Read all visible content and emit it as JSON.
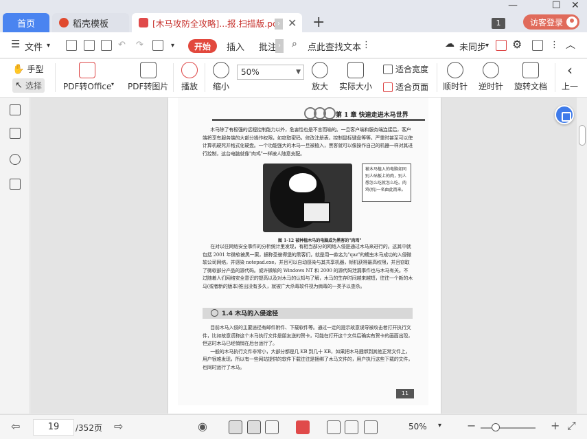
{
  "tabs": {
    "home": "首页",
    "template": "稻壳模板",
    "doc": "[木马攻防全攻略]...报.扫描版.pdf",
    "count": "1"
  },
  "account": {
    "login": "访客登录"
  },
  "menu": {
    "file": "文件",
    "start": "开始",
    "insert": "插入",
    "annotate": "批注",
    "search": "点此查找文本",
    "sync": "未同步"
  },
  "toolbar": {
    "hand": "手型",
    "select": "选择",
    "pdf_to_office": "PDF转Office",
    "pdf_to_image": "PDF转图片",
    "play": "播放",
    "zoom_out": "缩小",
    "zoom_value": "50%",
    "zoom_in": "放大",
    "actual_size": "实际大小",
    "fit_width": "适合宽度",
    "fit_page": "适合页面",
    "rotate_cw": "顺时针",
    "rotate_ccw": "逆时针",
    "rotate_doc": "旋转文档",
    "prev": "上一"
  },
  "document": {
    "chapter_title": "第 1 章   快速走进木马世界",
    "para1": "木马除了有极强的远程控制能力以外，危害性也是不言而喻的。一旦客户端和服务端连接后，客户端将享有服务端的大部分操作权限，如窃取密码，修改注册表，控制鼠标键盘等等。严重时甚至可以使计算机硬死并格式化硬盘。一个功能强大的木马一旦被植入，黑客就可以像操作自己的机器一样对其进行控制，这台电脑就像\"肉鸡\"一样被人随意支配。",
    "speech": "被木马植入的电脑如同别人砧板上的肉，别人想怎么吃就怎么吃。肉鸡(机)一名由此而来。",
    "figure_caption": "图 1-12  被种植木马的电脑成为黑客的\"肉鸡\"",
    "para2": "在对以往网络安全事件的分析统计里发现，有相当部分的网络入侵是通过木马来进行的。这其中就包括 2001 年微软被黑一案，据称圣彼得堡的黑客们，就是用一款名为\"qaz\"的蠕虫木马成功的入侵微软公司网络，并感染 notepad.exe，并且可以自动感染与其共享机器，帧机获得最高权限，并且窃取了微软部分产品的源代码。或许微软的 Windows NT 和 2000 的源代码泄漏事件也与木马有关。不过随着人们网络安全意识的提高以及对木马的认知与了解，木马的生存时间越来越短，往往一个新的木马(或者新的版本)推出没有多久，就被广大杀毒软件视为病毒的一类予以查杀。",
    "section_title": "1.4  木马的入侵途径",
    "para3": "目前木马入侵的主要途径有邮件附件、下载软件等。通过一定的提示故意误导被攻击者打开执行文件，比如故意谎称这个木马执行文件是朋友送的贺卡，可能在打开这个文件后确实有贺卡的画面出现，但这时木马已经悄悄在后台运行了。",
    "para4": "一般的木马执行文件非常小，大部分都是几 KB 到几十 KB，如果把木马捆绑到其他正常文件上，用户很难发现，所以有一些网站提供的软件下载往往是捆绑了木马文件的，用户执行这些下载的文件，也同时运行了木马。",
    "page_number": "11"
  },
  "status": {
    "page": "19",
    "total": "/352页",
    "zoom": "50%"
  }
}
